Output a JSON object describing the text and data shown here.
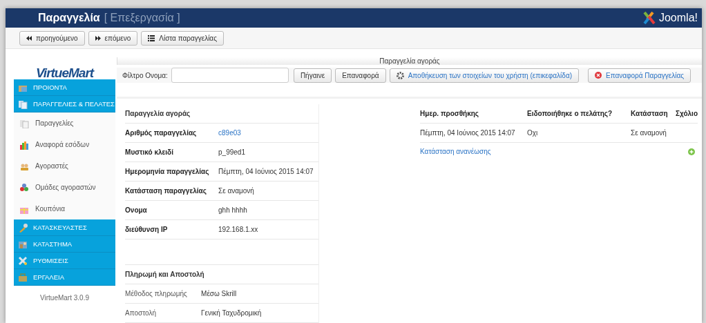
{
  "header": {
    "title": "Παραγγελία",
    "subtitle": "[ Επεξεργασία ]",
    "brand": "Joomla!"
  },
  "toolbar": [
    "προηγούμενο",
    "επόμενο",
    "Λίστα παραγγελίας"
  ],
  "sidebar": {
    "logo": "VirtueMart",
    "version": "VirtueMart 3.0.9",
    "sections": [
      {
        "label": "ΠΡΟΙΟΝΤΑ"
      },
      {
        "label": "ΠΑΡΑΓΓΕΛΙΕΣ & ΠΕΛΑΤΕΣ",
        "children": [
          "Παραγγελίες",
          "Αναφορά εσόδων",
          "Αγοραστές",
          "Ομάδες αγοραστών",
          "Κουπόνια"
        ]
      },
      {
        "label": "ΚΑΤΑΣΚΕΥΑΣΤΕΣ"
      },
      {
        "label": "ΚΑΤΑΣΤΗΜΑ"
      },
      {
        "label": "ΡΥΘΜΙΣΕΙΣ"
      },
      {
        "label": "ΕΡΓΑΛΕΙΑ"
      }
    ]
  },
  "panel_title": "Παραγγελία αγοράς",
  "filter": {
    "label": "Φίλτρο Ονομα:",
    "buttons": [
      {
        "label": "Πήγαινε",
        "kind": "plain"
      },
      {
        "label": "Επαναφορά",
        "kind": "plain"
      },
      {
        "label": "Αποθήκευση των στοιχείων του χρήστη (επικεφαλίδα)",
        "kind": "save"
      },
      {
        "label": "Επαναφορά Παραγγελίας",
        "kind": "reset"
      }
    ]
  },
  "order": {
    "title": "Παραγγελία αγοράς",
    "rows": [
      {
        "label": "Αριθμός παραγγελίας",
        "value": "c89e03",
        "kind": "link"
      },
      {
        "label": "Μυστικό κλειδί",
        "value": "p_99ed1",
        "kind": "text"
      },
      {
        "label": "Ημερομηνία παραγγελίας",
        "value": "Πέμπτη, 04 Ιούνιος 2015 14:07",
        "kind": "text"
      },
      {
        "label": "Κατάσταση παραγγελίας",
        "value": "Σε αναμονή",
        "kind": "text"
      },
      {
        "label": "Ονομα",
        "value": "ghh hhhh",
        "kind": "text"
      },
      {
        "label": "διεύθυνση IP",
        "value": "192.168.1.xx",
        "kind": "text"
      }
    ]
  },
  "payment": {
    "title": "Πληρωμή και Αποστολή",
    "rows": [
      {
        "label": "Μέθοδος πληρωμής",
        "value": "Μέσω Skrill"
      },
      {
        "label": "Αποστολή",
        "value": "Γενική Ταχυδρομική"
      }
    ]
  },
  "history": {
    "columns": [
      "Ημερ. προσθήκης",
      "Ειδοποιήθηκε ο πελάτης?",
      "Κατάσταση",
      "Σχόλιο"
    ],
    "rows": [
      [
        "Πέμπτη, 04 Ιούνιος 2015 14:07",
        "Οχι",
        "Σε αναμονή",
        ""
      ]
    ],
    "update_link": "Κατάσταση ανανέωσης"
  }
}
